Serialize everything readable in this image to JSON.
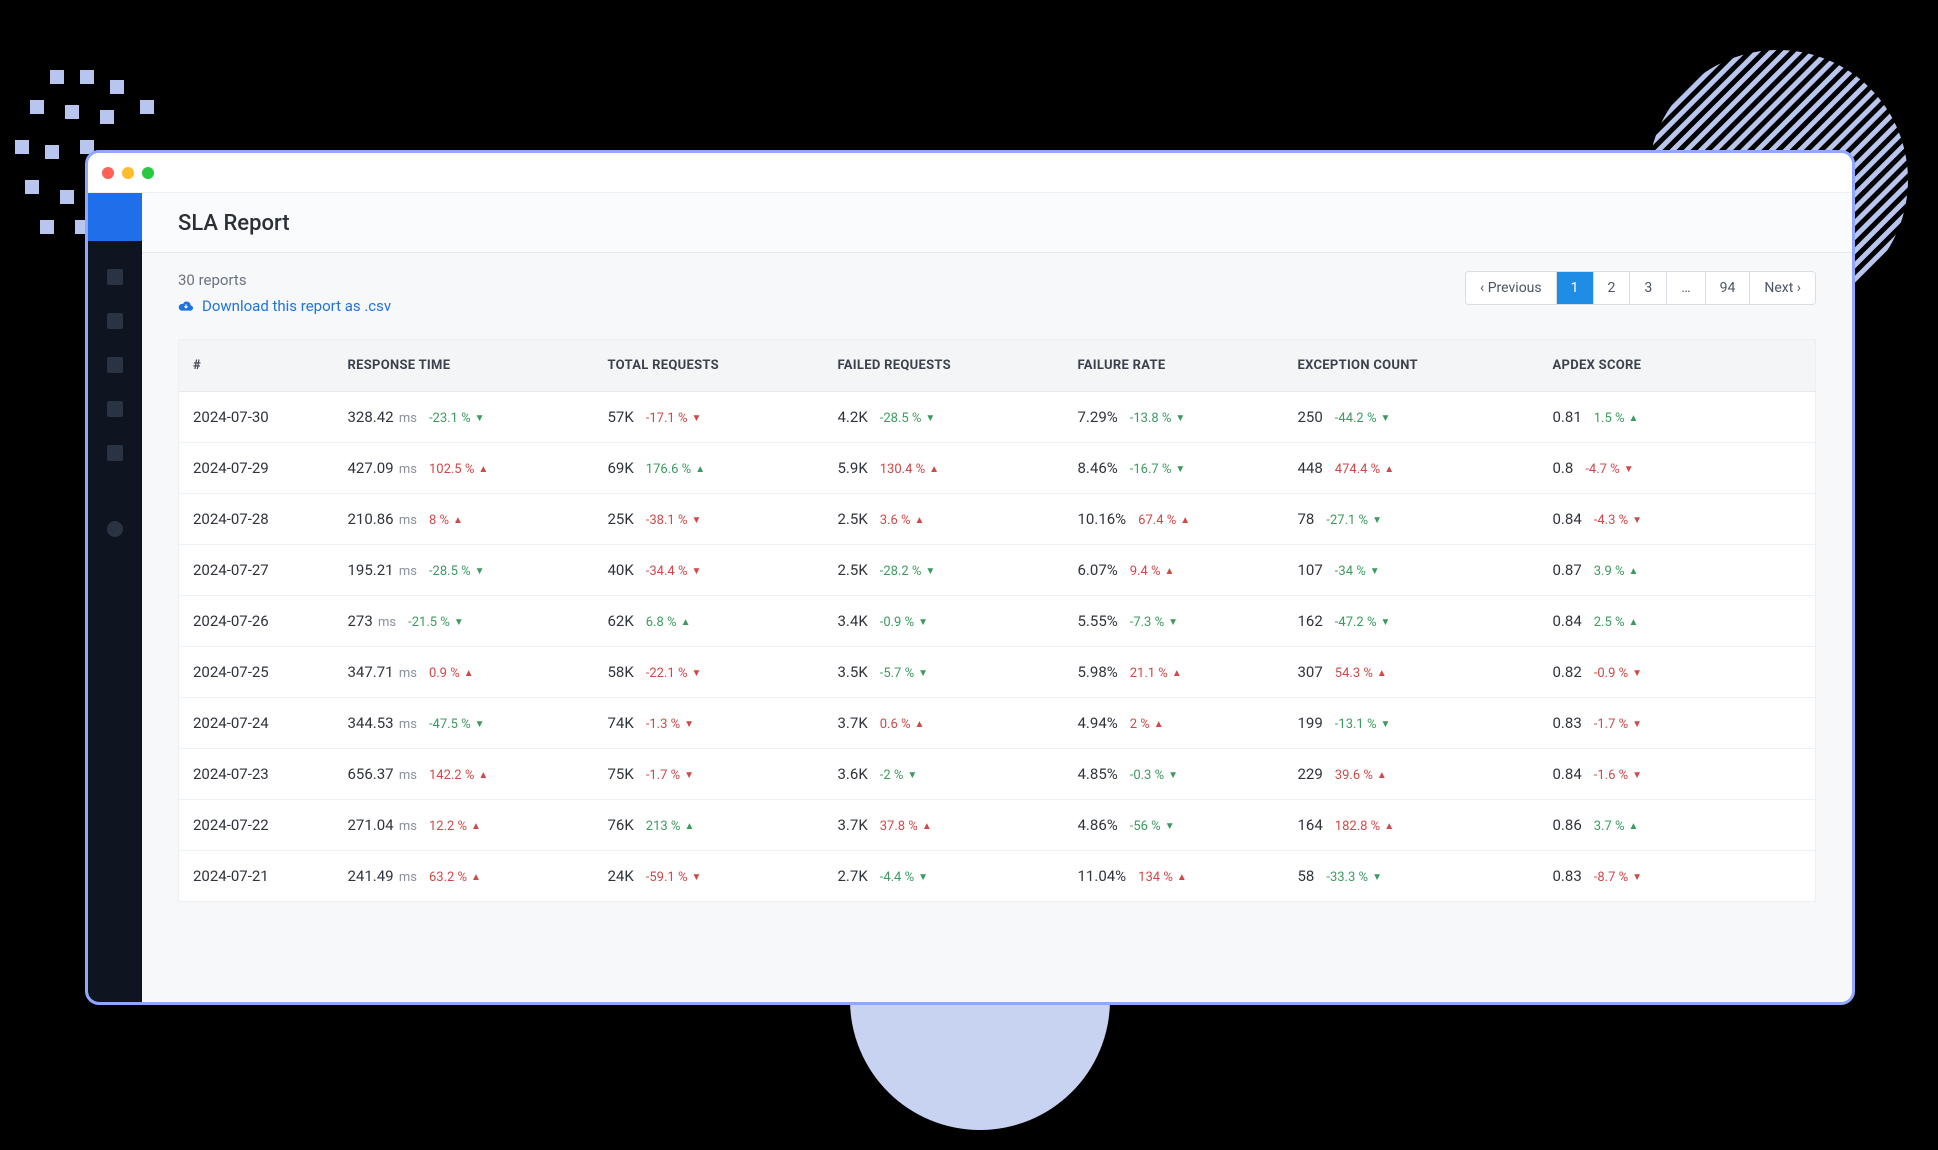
{
  "header": {
    "title": "SLA Report"
  },
  "toolbar": {
    "reports_count": "30 reports",
    "download_label": "Download this report as .csv"
  },
  "pagination": {
    "prev": "‹ Previous",
    "pages": [
      "1",
      "2",
      "3",
      "…",
      "94"
    ],
    "active_index": 0,
    "next": "Next ›"
  },
  "table": {
    "columns": [
      "#",
      "RESPONSE TIME",
      "TOTAL REQUESTS",
      "FAILED REQUESTS",
      "FAILURE RATE",
      "EXCEPTION COUNT",
      "APDEX SCORE"
    ],
    "rows": [
      {
        "date": "2024-07-30",
        "response_time": {
          "value": "328.42",
          "unit": "ms",
          "delta": "-23.1 %",
          "dir": "down"
        },
        "total_requests": {
          "value": "57K",
          "delta": "-17.1 %",
          "dir": "down",
          "delta_color": "up"
        },
        "failed_requests": {
          "value": "4.2K",
          "delta": "-28.5 %",
          "dir": "down"
        },
        "failure_rate": {
          "value": "7.29%",
          "delta": "-13.8 %",
          "dir": "down"
        },
        "exception_count": {
          "value": "250",
          "delta": "-44.2 %",
          "dir": "down"
        },
        "apdex": {
          "value": "0.81",
          "delta": "1.5 %",
          "dir": "up",
          "delta_color": "down"
        }
      },
      {
        "date": "2024-07-29",
        "response_time": {
          "value": "427.09",
          "unit": "ms",
          "delta": "102.5 %",
          "dir": "up"
        },
        "total_requests": {
          "value": "69K",
          "delta": "176.6 %",
          "dir": "up",
          "delta_color": "down"
        },
        "failed_requests": {
          "value": "5.9K",
          "delta": "130.4 %",
          "dir": "up"
        },
        "failure_rate": {
          "value": "8.46%",
          "delta": "-16.7 %",
          "dir": "down"
        },
        "exception_count": {
          "value": "448",
          "delta": "474.4 %",
          "dir": "up"
        },
        "apdex": {
          "value": "0.8",
          "delta": "-4.7 %",
          "dir": "down",
          "delta_color": "up"
        }
      },
      {
        "date": "2024-07-28",
        "response_time": {
          "value": "210.86",
          "unit": "ms",
          "delta": "8 %",
          "dir": "up"
        },
        "total_requests": {
          "value": "25K",
          "delta": "-38.1 %",
          "dir": "down",
          "delta_color": "up"
        },
        "failed_requests": {
          "value": "2.5K",
          "delta": "3.6 %",
          "dir": "up"
        },
        "failure_rate": {
          "value": "10.16%",
          "delta": "67.4 %",
          "dir": "up"
        },
        "exception_count": {
          "value": "78",
          "delta": "-27.1 %",
          "dir": "down"
        },
        "apdex": {
          "value": "0.84",
          "delta": "-4.3 %",
          "dir": "down",
          "delta_color": "up"
        }
      },
      {
        "date": "2024-07-27",
        "response_time": {
          "value": "195.21",
          "unit": "ms",
          "delta": "-28.5 %",
          "dir": "down"
        },
        "total_requests": {
          "value": "40K",
          "delta": "-34.4 %",
          "dir": "down",
          "delta_color": "up"
        },
        "failed_requests": {
          "value": "2.5K",
          "delta": "-28.2 %",
          "dir": "down"
        },
        "failure_rate": {
          "value": "6.07%",
          "delta": "9.4 %",
          "dir": "up"
        },
        "exception_count": {
          "value": "107",
          "delta": "-34 %",
          "dir": "down"
        },
        "apdex": {
          "value": "0.87",
          "delta": "3.9 %",
          "dir": "up",
          "delta_color": "down"
        }
      },
      {
        "date": "2024-07-26",
        "response_time": {
          "value": "273",
          "unit": "ms",
          "delta": "-21.5 %",
          "dir": "down"
        },
        "total_requests": {
          "value": "62K",
          "delta": "6.8 %",
          "dir": "up",
          "delta_color": "down"
        },
        "failed_requests": {
          "value": "3.4K",
          "delta": "-0.9 %",
          "dir": "down"
        },
        "failure_rate": {
          "value": "5.55%",
          "delta": "-7.3 %",
          "dir": "down"
        },
        "exception_count": {
          "value": "162",
          "delta": "-47.2 %",
          "dir": "down"
        },
        "apdex": {
          "value": "0.84",
          "delta": "2.5 %",
          "dir": "up",
          "delta_color": "down"
        }
      },
      {
        "date": "2024-07-25",
        "response_time": {
          "value": "347.71",
          "unit": "ms",
          "delta": "0.9 %",
          "dir": "up"
        },
        "total_requests": {
          "value": "58K",
          "delta": "-22.1 %",
          "dir": "down",
          "delta_color": "up"
        },
        "failed_requests": {
          "value": "3.5K",
          "delta": "-5.7 %",
          "dir": "down"
        },
        "failure_rate": {
          "value": "5.98%",
          "delta": "21.1 %",
          "dir": "up"
        },
        "exception_count": {
          "value": "307",
          "delta": "54.3 %",
          "dir": "up"
        },
        "apdex": {
          "value": "0.82",
          "delta": "-0.9 %",
          "dir": "down",
          "delta_color": "up"
        }
      },
      {
        "date": "2024-07-24",
        "response_time": {
          "value": "344.53",
          "unit": "ms",
          "delta": "-47.5 %",
          "dir": "down"
        },
        "total_requests": {
          "value": "74K",
          "delta": "-1.3 %",
          "dir": "down",
          "delta_color": "up"
        },
        "failed_requests": {
          "value": "3.7K",
          "delta": "0.6 %",
          "dir": "up"
        },
        "failure_rate": {
          "value": "4.94%",
          "delta": "2 %",
          "dir": "up"
        },
        "exception_count": {
          "value": "199",
          "delta": "-13.1 %",
          "dir": "down"
        },
        "apdex": {
          "value": "0.83",
          "delta": "-1.7 %",
          "dir": "down",
          "delta_color": "up"
        }
      },
      {
        "date": "2024-07-23",
        "response_time": {
          "value": "656.37",
          "unit": "ms",
          "delta": "142.2 %",
          "dir": "up"
        },
        "total_requests": {
          "value": "75K",
          "delta": "-1.7 %",
          "dir": "down",
          "delta_color": "up"
        },
        "failed_requests": {
          "value": "3.6K",
          "delta": "-2 %",
          "dir": "down"
        },
        "failure_rate": {
          "value": "4.85%",
          "delta": "-0.3 %",
          "dir": "down"
        },
        "exception_count": {
          "value": "229",
          "delta": "39.6 %",
          "dir": "up"
        },
        "apdex": {
          "value": "0.84",
          "delta": "-1.6 %",
          "dir": "down",
          "delta_color": "up"
        }
      },
      {
        "date": "2024-07-22",
        "response_time": {
          "value": "271.04",
          "unit": "ms",
          "delta": "12.2 %",
          "dir": "up"
        },
        "total_requests": {
          "value": "76K",
          "delta": "213 %",
          "dir": "up",
          "delta_color": "down"
        },
        "failed_requests": {
          "value": "3.7K",
          "delta": "37.8 %",
          "dir": "up"
        },
        "failure_rate": {
          "value": "4.86%",
          "delta": " -56 %",
          "dir": "down"
        },
        "exception_count": {
          "value": "164",
          "delta": "182.8 %",
          "dir": "up"
        },
        "apdex": {
          "value": "0.86",
          "delta": "3.7 %",
          "dir": "up",
          "delta_color": "down"
        }
      },
      {
        "date": "2024-07-21",
        "response_time": {
          "value": "241.49",
          "unit": "ms",
          "delta": "63.2 %",
          "dir": "up"
        },
        "total_requests": {
          "value": "24K",
          "delta": "-59.1 %",
          "dir": "down",
          "delta_color": "up"
        },
        "failed_requests": {
          "value": "2.7K",
          "delta": "-4.4 %",
          "dir": "down"
        },
        "failure_rate": {
          "value": "11.04%",
          "delta": "134 %",
          "dir": "up"
        },
        "exception_count": {
          "value": "58",
          "delta": "-33.3 %",
          "dir": "down"
        },
        "apdex": {
          "value": "0.83",
          "delta": "-8.7 %",
          "dir": "down",
          "delta_color": "up"
        }
      }
    ]
  }
}
